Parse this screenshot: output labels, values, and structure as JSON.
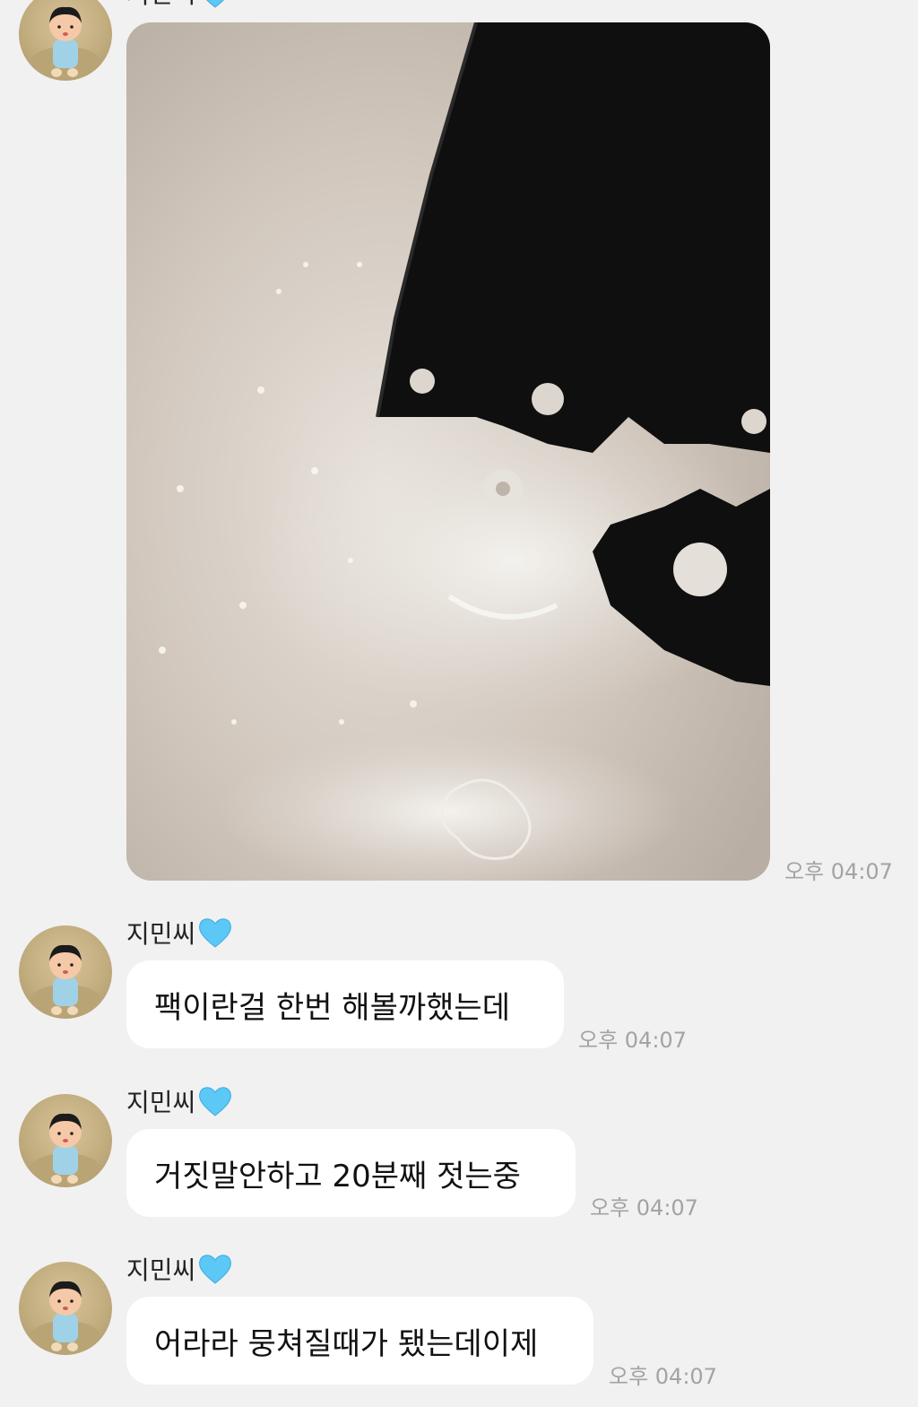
{
  "chat": {
    "sender_name": "지민씨",
    "messages": [
      {
        "type": "image",
        "image_alt": "",
        "time": "오후 04:07"
      },
      {
        "type": "text",
        "text": "팩이란걸 한번 해볼까했는데",
        "time": "오후 04:07"
      },
      {
        "type": "text",
        "text": "거짓말안하고 20분째 젓는중",
        "time": "오후 04:07"
      },
      {
        "type": "text",
        "text": "어라라 뭉쳐질때가 됐는데이제",
        "time": "오후 04:07"
      }
    ]
  },
  "icons": {
    "sender_badge": "blue-heart-icon",
    "avatar": "cartoon-boy-avatar-icon"
  },
  "colors": {
    "background": "#f1f1f1",
    "bubble": "#ffffff",
    "time": "#a3a3a3",
    "heart": "#5bc8f5"
  }
}
